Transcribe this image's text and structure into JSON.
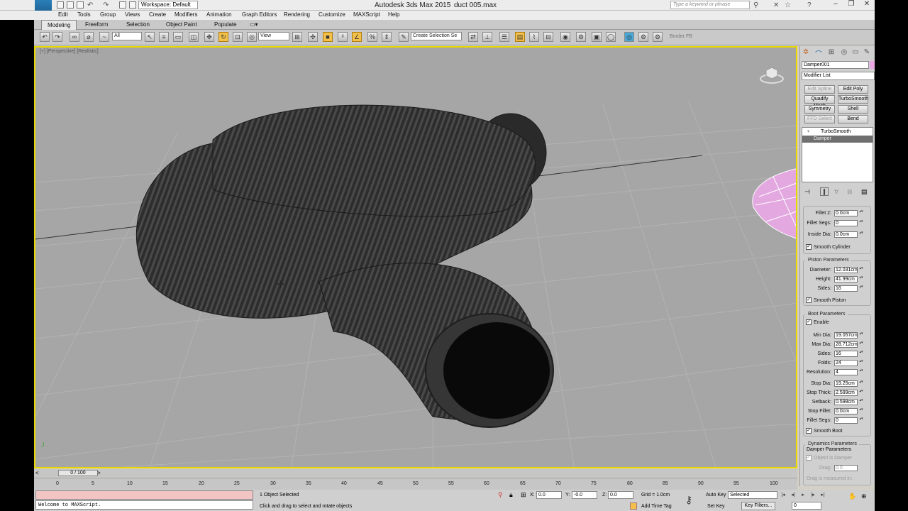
{
  "titlebar": {
    "workspace": "Workspace: Default",
    "app_title": "Autodesk 3ds Max  2015",
    "file_name": "duct 005.max",
    "search_placeholder": "Type a keyword or phrase",
    "logo_text": "MAX"
  },
  "menu": [
    "Edit",
    "Tools",
    "Group",
    "Views",
    "Create",
    "Modifiers",
    "Animation",
    "Graph Editors",
    "Rendering",
    "Customize",
    "MAXScript",
    "Help"
  ],
  "ribbon_tabs": [
    "Modeling",
    "Freeform",
    "Selection",
    "Object Paint",
    "Populate"
  ],
  "toolbar": {
    "filter": "All",
    "ref_coord": "View",
    "named_selection": "Create Selection Se",
    "border_label": "Border FB"
  },
  "viewport": {
    "label": "[+] [Perspective] [Realistic]"
  },
  "command_panel": {
    "object_name": "Damper001",
    "modifier_list": "Modifier List",
    "mod_buttons": [
      "Edit Spline",
      "Edit Poly",
      "Quadify Mesh",
      "TurboSmooth",
      "Symmetry",
      "Shell",
      "FFD Select",
      "Bend"
    ],
    "stack": [
      "TurboSmooth",
      "Damper"
    ],
    "params_top": [
      {
        "label": "Fillet 2:",
        "value": "0.0cm"
      },
      {
        "label": "Fillet Segs:",
        "value": "0"
      },
      {
        "label": "Inside Dia:",
        "value": "0.0cm"
      }
    ],
    "smooth_cylinder": "Smooth Cylinder",
    "piston_title": "Piston Parameters",
    "piston": [
      {
        "label": "Diameter:",
        "value": "12.031cm"
      },
      {
        "label": "Height:",
        "value": "41.99cm"
      },
      {
        "label": "Sides:",
        "value": "16"
      }
    ],
    "smooth_piston": "Smooth Piston",
    "boot_title": "Boot Parameters",
    "enable": "Enable",
    "boot": [
      {
        "label": "Min Dia:",
        "value": "19.057cm"
      },
      {
        "label": "Max Dia:",
        "value": "28.712cm"
      },
      {
        "label": "Sides:",
        "value": "16"
      },
      {
        "label": "Folds:",
        "value": "24"
      },
      {
        "label": "Resolution:",
        "value": "4"
      },
      {
        "label": "Stop Dia:",
        "value": "19.25cm"
      },
      {
        "label": "Stop Thick:",
        "value": "2.599cm"
      },
      {
        "label": "Setback:",
        "value": "0.598cm"
      },
      {
        "label": "Stop Fillet:",
        "value": "0.0cm"
      },
      {
        "label": "Fillet Segs:",
        "value": "0"
      }
    ],
    "smooth_boot": "Smooth Boot",
    "dynamics_title": "Dynamics Parameters",
    "damper_params": "Damper Parameters",
    "object_is_damper": "Object is Damper",
    "drag_label": "Drag:",
    "drag_value": "0.0",
    "drag_measured": "Drag is measured in:"
  },
  "timeline": {
    "slider": "0 / 100",
    "ticks": [
      "0",
      "5",
      "10",
      "15",
      "20",
      "25",
      "30",
      "35",
      "40",
      "45",
      "50",
      "55",
      "60",
      "65",
      "70",
      "75",
      "80",
      "85",
      "90",
      "95",
      "100"
    ]
  },
  "status": {
    "listener": "Welcome to MAXScript.",
    "selection": "1 Object Selected",
    "prompt": "Click and drag to select and rotate objects",
    "x_label": "X:",
    "x_value": "0.0",
    "y_label": "Y:",
    "y_value": "-0.0",
    "z_label": "Z:",
    "z_value": "0.0",
    "grid": "Grid = 1.0cm",
    "add_time_tag": "Add Time Tag",
    "auto_key": "Auto Key",
    "set_key": "Set Key",
    "selected": "Selected",
    "key_filters": "Key Filters...",
    "frame": "0"
  }
}
